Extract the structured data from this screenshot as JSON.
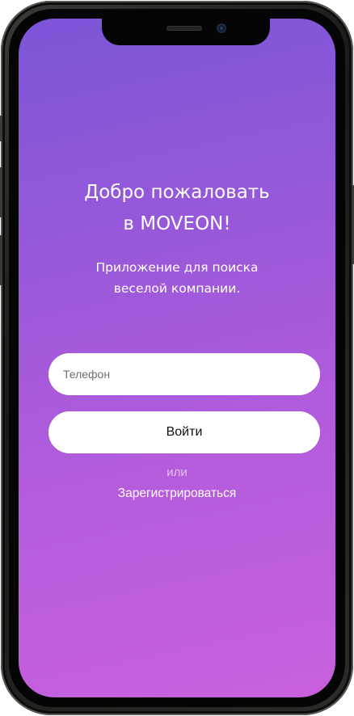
{
  "welcome": {
    "title_line1": "Добро пожаловать",
    "title_line2": "в MOVEON!",
    "subtitle_line1": "Приложение для поиска",
    "subtitle_line2": "веселой компании."
  },
  "login_form": {
    "phone_placeholder": "Телефон",
    "phone_value": "",
    "login_button_label": "Войти",
    "or_label": "или",
    "register_link_label": "Зарегистрироваться"
  },
  "colors": {
    "gradient_top": "#7c55d8",
    "gradient_bottom": "#c960dd",
    "button_background": "#ffffff"
  },
  "icons": {
    "earpiece": "speaker-icon",
    "front_camera": "camera-icon"
  }
}
